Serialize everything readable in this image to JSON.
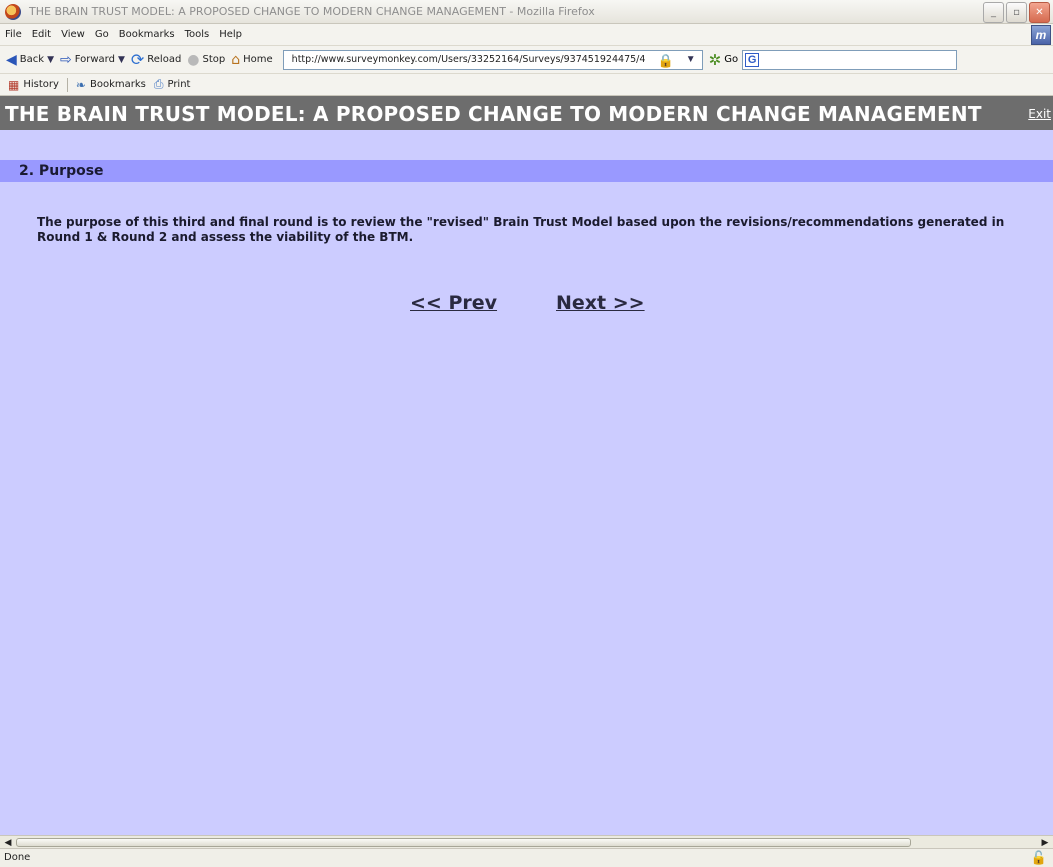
{
  "window": {
    "title": "THE BRAIN TRUST MODEL: A PROPOSED CHANGE TO MODERN CHANGE MANAGEMENT - Mozilla Firefox",
    "minimize_glyph": "_",
    "maximize_glyph": "▫",
    "close_glyph": "✕"
  },
  "menubar": {
    "items": [
      "File",
      "Edit",
      "View",
      "Go",
      "Bookmarks",
      "Tools",
      "Help"
    ]
  },
  "navbar": {
    "back_label": "Back",
    "forward_label": "Forward",
    "reload_label": "Reload",
    "stop_label": "Stop",
    "home_label": "Home",
    "url": "http://www.surveymonkey.com/Users/33252164/Surveys/937451924475/4",
    "go_label": "Go",
    "search_engine_glyph": "G",
    "search_value": ""
  },
  "bookmarks_toolbar": {
    "history_label": "History",
    "bookmarks_label": "Bookmarks",
    "print_label": "Print"
  },
  "survey": {
    "title": "THE BRAIN TRUST MODEL: A PROPOSED CHANGE TO MODERN CHANGE MANAGEMENT",
    "exit_label": "Exit",
    "section_title": "2. Purpose",
    "purpose_text": "The purpose of this third and final round is to review the \"revised\" Brain Trust Model based upon the revisions/recommendations generated in Round 1 & Round 2 and assess the viability of the BTM.",
    "prev_label": "<< Prev",
    "next_label": "Next >>"
  },
  "statusbar": {
    "text": "Done"
  },
  "colors": {
    "page_background": "#ccccff",
    "title_bar": "#6d6d6d",
    "section_bar": "#9999ff"
  },
  "icons": {
    "app": "firefox-icon",
    "back": "back-arrow-icon",
    "forward": "forward-arrow-icon",
    "reload": "reload-icon",
    "stop": "stop-icon",
    "home": "home-icon",
    "lock": "padlock-icon",
    "go": "go-icon",
    "history": "history-icon",
    "bookmarks": "bookmarks-icon",
    "print": "print-icon"
  }
}
